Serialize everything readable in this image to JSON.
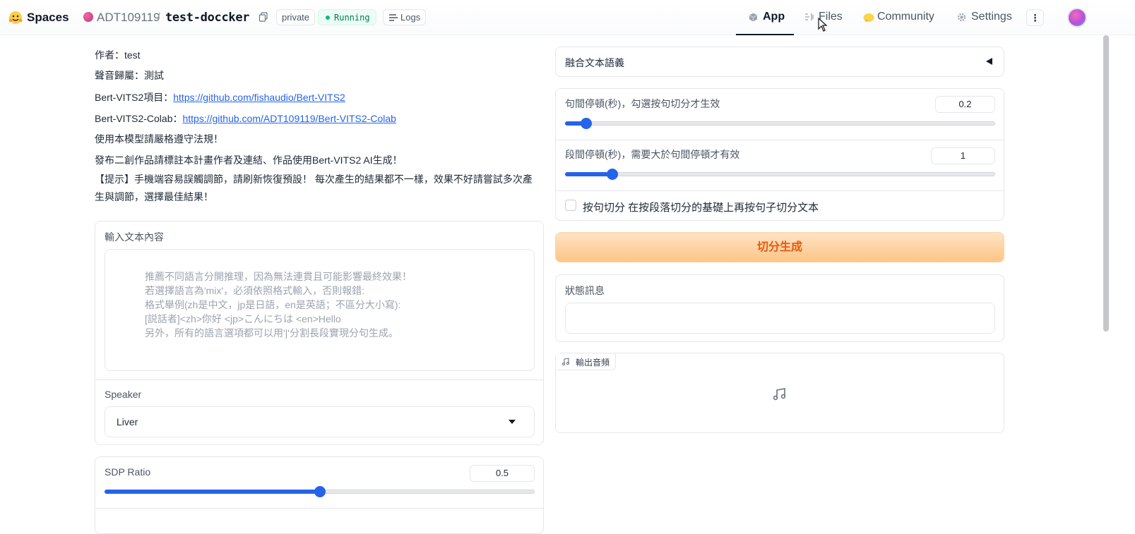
{
  "header": {
    "brand": "Spaces",
    "owner": "ADT109119",
    "separator": "/",
    "repo": "test-doccker",
    "visibility": "private",
    "status": "Running",
    "logs_label": "Logs",
    "tabs": [
      {
        "label": "App",
        "icon": "cube-icon",
        "active": true
      },
      {
        "label": "Files",
        "icon": "files-icon"
      },
      {
        "label": "Community",
        "icon": "community-icon"
      },
      {
        "label": "Settings",
        "icon": "gear-icon"
      }
    ],
    "more_label": "⋮"
  },
  "intro": {
    "author": "作者：test",
    "voice": "聲音歸屬：測試",
    "bert_prefix": "Bert-VITS2項目：",
    "bert_link": "https://github.com/fishaudio/Bert-VITS2",
    "colab_prefix": "Bert-VITS2-Colab：",
    "colab_link": "https://github.com/ADT109119/Bert-VITS2-Colab",
    "law": "使用本模型請嚴格遵守法規！",
    "credit": "發布二創作品請標註本計畫作者及連結、作品使用Bert-VITS2 AI生成！",
    "tip": "【提示】手機端容易誤觸調節，請刷新恢復預設！ 每次產生的結果都不一樣，效果不好請嘗試多次產生與調節，選擇最佳結果！"
  },
  "input_panel": {
    "label": "輸入文本內容",
    "placeholder": "推薦不同語言分開推理，因為無法連貫且可能影響最終效果！\n若選擇語言為'mix'，必須依照格式輸入，否則報錯:\n格式舉例(zh是中文，jp是日語，en是英語；不區分大小寫):\n[説話者]<zh>你好 <jp>こんにちは <en>Hello\n另外，所有的語言選項都可以用'|'分割長段實現分句生成。",
    "speaker_label": "Speaker",
    "speaker_value": "Liver"
  },
  "sdp": {
    "label": "SDP Ratio",
    "value": "0.5",
    "fraction": 0.5
  },
  "right": {
    "accordion_label": "融合文本語義",
    "sentence_pause_label": "句間停頓(秒)，勾選按句切分才生效",
    "sentence_pause_value": "0.2",
    "sentence_pause_fraction": 0.05,
    "para_pause_label": "段間停頓(秒)，需要大於句間停頓才有效",
    "para_pause_value": "1",
    "para_pause_fraction": 0.11,
    "checkbox_label": "按句切分 在按段落切分的基礎上再按句子切分文本",
    "generate_label": "切分生成",
    "status_label": "狀態訊息",
    "audio_label": "輸出音頻"
  },
  "colors": {
    "accent": "#2563eb",
    "running": "#10b981",
    "generate_text": "#ea580c"
  }
}
